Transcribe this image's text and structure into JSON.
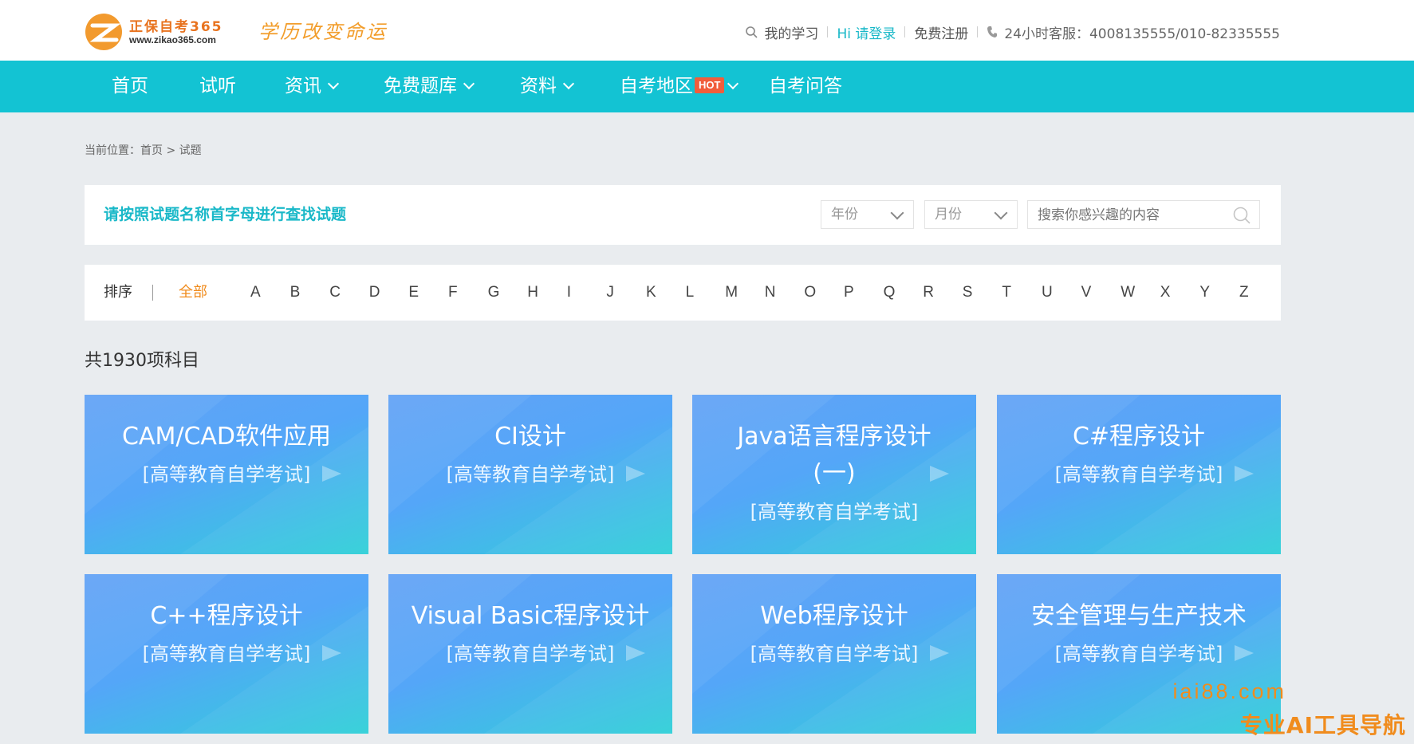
{
  "header": {
    "logo_name": "正保自考365",
    "logo_url": "www.zikao365.com",
    "slogan": "学历改变命运",
    "links": {
      "my_study": "我的学习",
      "login": "Hi 请登录",
      "register": "免费注册",
      "hotline": "24小时客服：4008135555/010-82335555"
    }
  },
  "nav": {
    "items": [
      {
        "label": "首页"
      },
      {
        "label": "试听"
      },
      {
        "label": "资讯"
      },
      {
        "label": "免费题库"
      },
      {
        "label": "资料"
      },
      {
        "label": "自考地区",
        "badge": "HOT"
      },
      {
        "label": "自考问答"
      }
    ]
  },
  "breadcrumb": {
    "prefix": "当前位置：",
    "home": "首页",
    "sep": " > ",
    "current": "试题"
  },
  "filter": {
    "title": "请按照试题名称首字母进行查找试题",
    "year_select": "年份",
    "month_select": "月份",
    "search_placeholder": "搜索你感兴趣的内容"
  },
  "letters": {
    "label": "排序",
    "all": "全部",
    "items": [
      "A",
      "B",
      "C",
      "D",
      "E",
      "F",
      "G",
      "H",
      "I",
      "J",
      "K",
      "L",
      "M",
      "N",
      "O",
      "P",
      "Q",
      "R",
      "S",
      "T",
      "U",
      "V",
      "W",
      "X",
      "Y",
      "Z"
    ]
  },
  "count_text": "共1930项科目",
  "cards": [
    {
      "title": "CAM/CAD软件应用",
      "subtitle": "[高等教育自学考试]"
    },
    {
      "title": "CI设计",
      "subtitle": "[高等教育自学考试]"
    },
    {
      "title": "Java语言程序设计",
      "title2": "(一)",
      "subtitle": "[高等教育自学考试]"
    },
    {
      "title": "C#程序设计",
      "subtitle": "[高等教育自学考试]"
    },
    {
      "title": "C++程序设计",
      "subtitle": "[高等教育自学考试]"
    },
    {
      "title": "Visual Basic程序设计",
      "subtitle": "[高等教育自学考试]"
    },
    {
      "title": "Web程序设计",
      "subtitle": "[高等教育自学考试]"
    },
    {
      "title": "安全管理与生产技术",
      "subtitle": "[高等教育自学考试]"
    }
  ],
  "watermark": {
    "domain": "iai88.com",
    "tagline": "专业AI工具导航"
  },
  "colors": {
    "accent": "#13c3d3",
    "highlight": "#f08c1e",
    "hot_badge": "#f15d3b"
  }
}
